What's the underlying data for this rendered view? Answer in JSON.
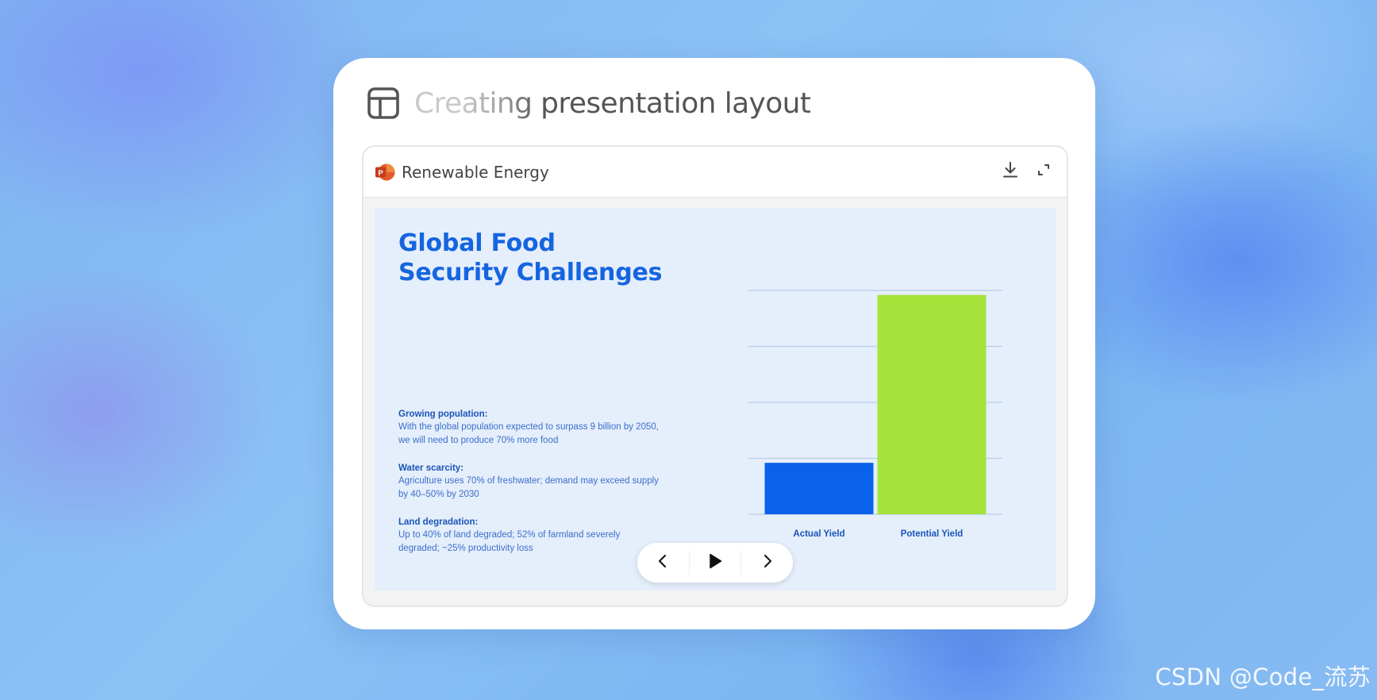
{
  "card": {
    "title": "Creating presentation layout",
    "title_icon": "layout-icon"
  },
  "viewer": {
    "file_name": "Renewable Energy",
    "file_icon": "powerpoint-icon",
    "actions": {
      "download_icon": "download-icon",
      "fullscreen_icon": "expand-icon"
    }
  },
  "slide": {
    "title_line1": "Global Food",
    "title_line2": "Security Challenges",
    "bullets": [
      {
        "title": "Growing population:",
        "text": "With the global population expected to surpass 9 billion by 2050, we will need to produce 70% more food"
      },
      {
        "title": "Water scarcity:",
        "text": "Agriculture uses 70% of freshwater; demand may exceed supply by 40–50% by 2030"
      },
      {
        "title": "Land degradation:",
        "text": "Up to 40% of land degraded; 52% of farmland severely degraded; ~25% productivity loss"
      }
    ]
  },
  "chart_data": {
    "type": "bar",
    "categories": [
      "Actual Yield",
      "Potential Yield"
    ],
    "values": [
      0.23,
      0.98
    ],
    "ylim": [
      0,
      1
    ],
    "grid": true,
    "bar_colors": [
      "#0a62ea",
      "#a6e33b"
    ],
    "category_label_color": "#1a55b8",
    "gridline_color": "#b8cdea"
  },
  "controls": {
    "prev_icon": "chevron-left-icon",
    "play_icon": "play-icon",
    "next_icon": "chevron-right-icon"
  },
  "watermark": "CSDN @Code_流苏",
  "colors": {
    "accent": "#1565e0",
    "slide_bg": "#e5eefb"
  }
}
